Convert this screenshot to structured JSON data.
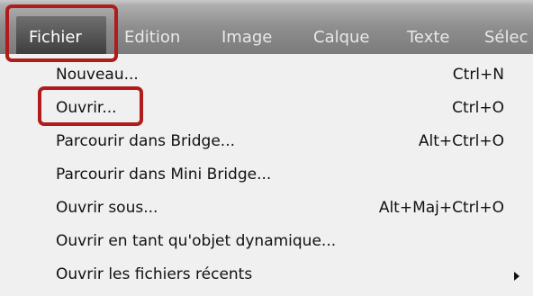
{
  "menubar": {
    "items": [
      {
        "label": "Fichier"
      },
      {
        "label": "Edition"
      },
      {
        "label": "Image"
      },
      {
        "label": "Calque"
      },
      {
        "label": "Texte"
      },
      {
        "label": "Sélec"
      }
    ]
  },
  "file_menu": {
    "items": [
      {
        "label": "Nouveau...",
        "shortcut": "Ctrl+N"
      },
      {
        "label": "Ouvrir...",
        "shortcut": "Ctrl+O"
      },
      {
        "label": "Parcourir dans Bridge...",
        "shortcut": "Alt+Ctrl+O"
      },
      {
        "label": "Parcourir dans Mini Bridge...",
        "shortcut": ""
      },
      {
        "label": "Ouvrir sous...",
        "shortcut": "Alt+Maj+Ctrl+O"
      },
      {
        "label": "Ouvrir en tant qu'objet dynamique...",
        "shortcut": ""
      },
      {
        "label": "Ouvrir les fichiers récents",
        "shortcut": ""
      }
    ]
  },
  "colors": {
    "highlight_outline": "#b01c1c",
    "menubar_active": "#3d3d3d",
    "menu_background": "#f0f0f0",
    "menu_text": "#111111"
  }
}
